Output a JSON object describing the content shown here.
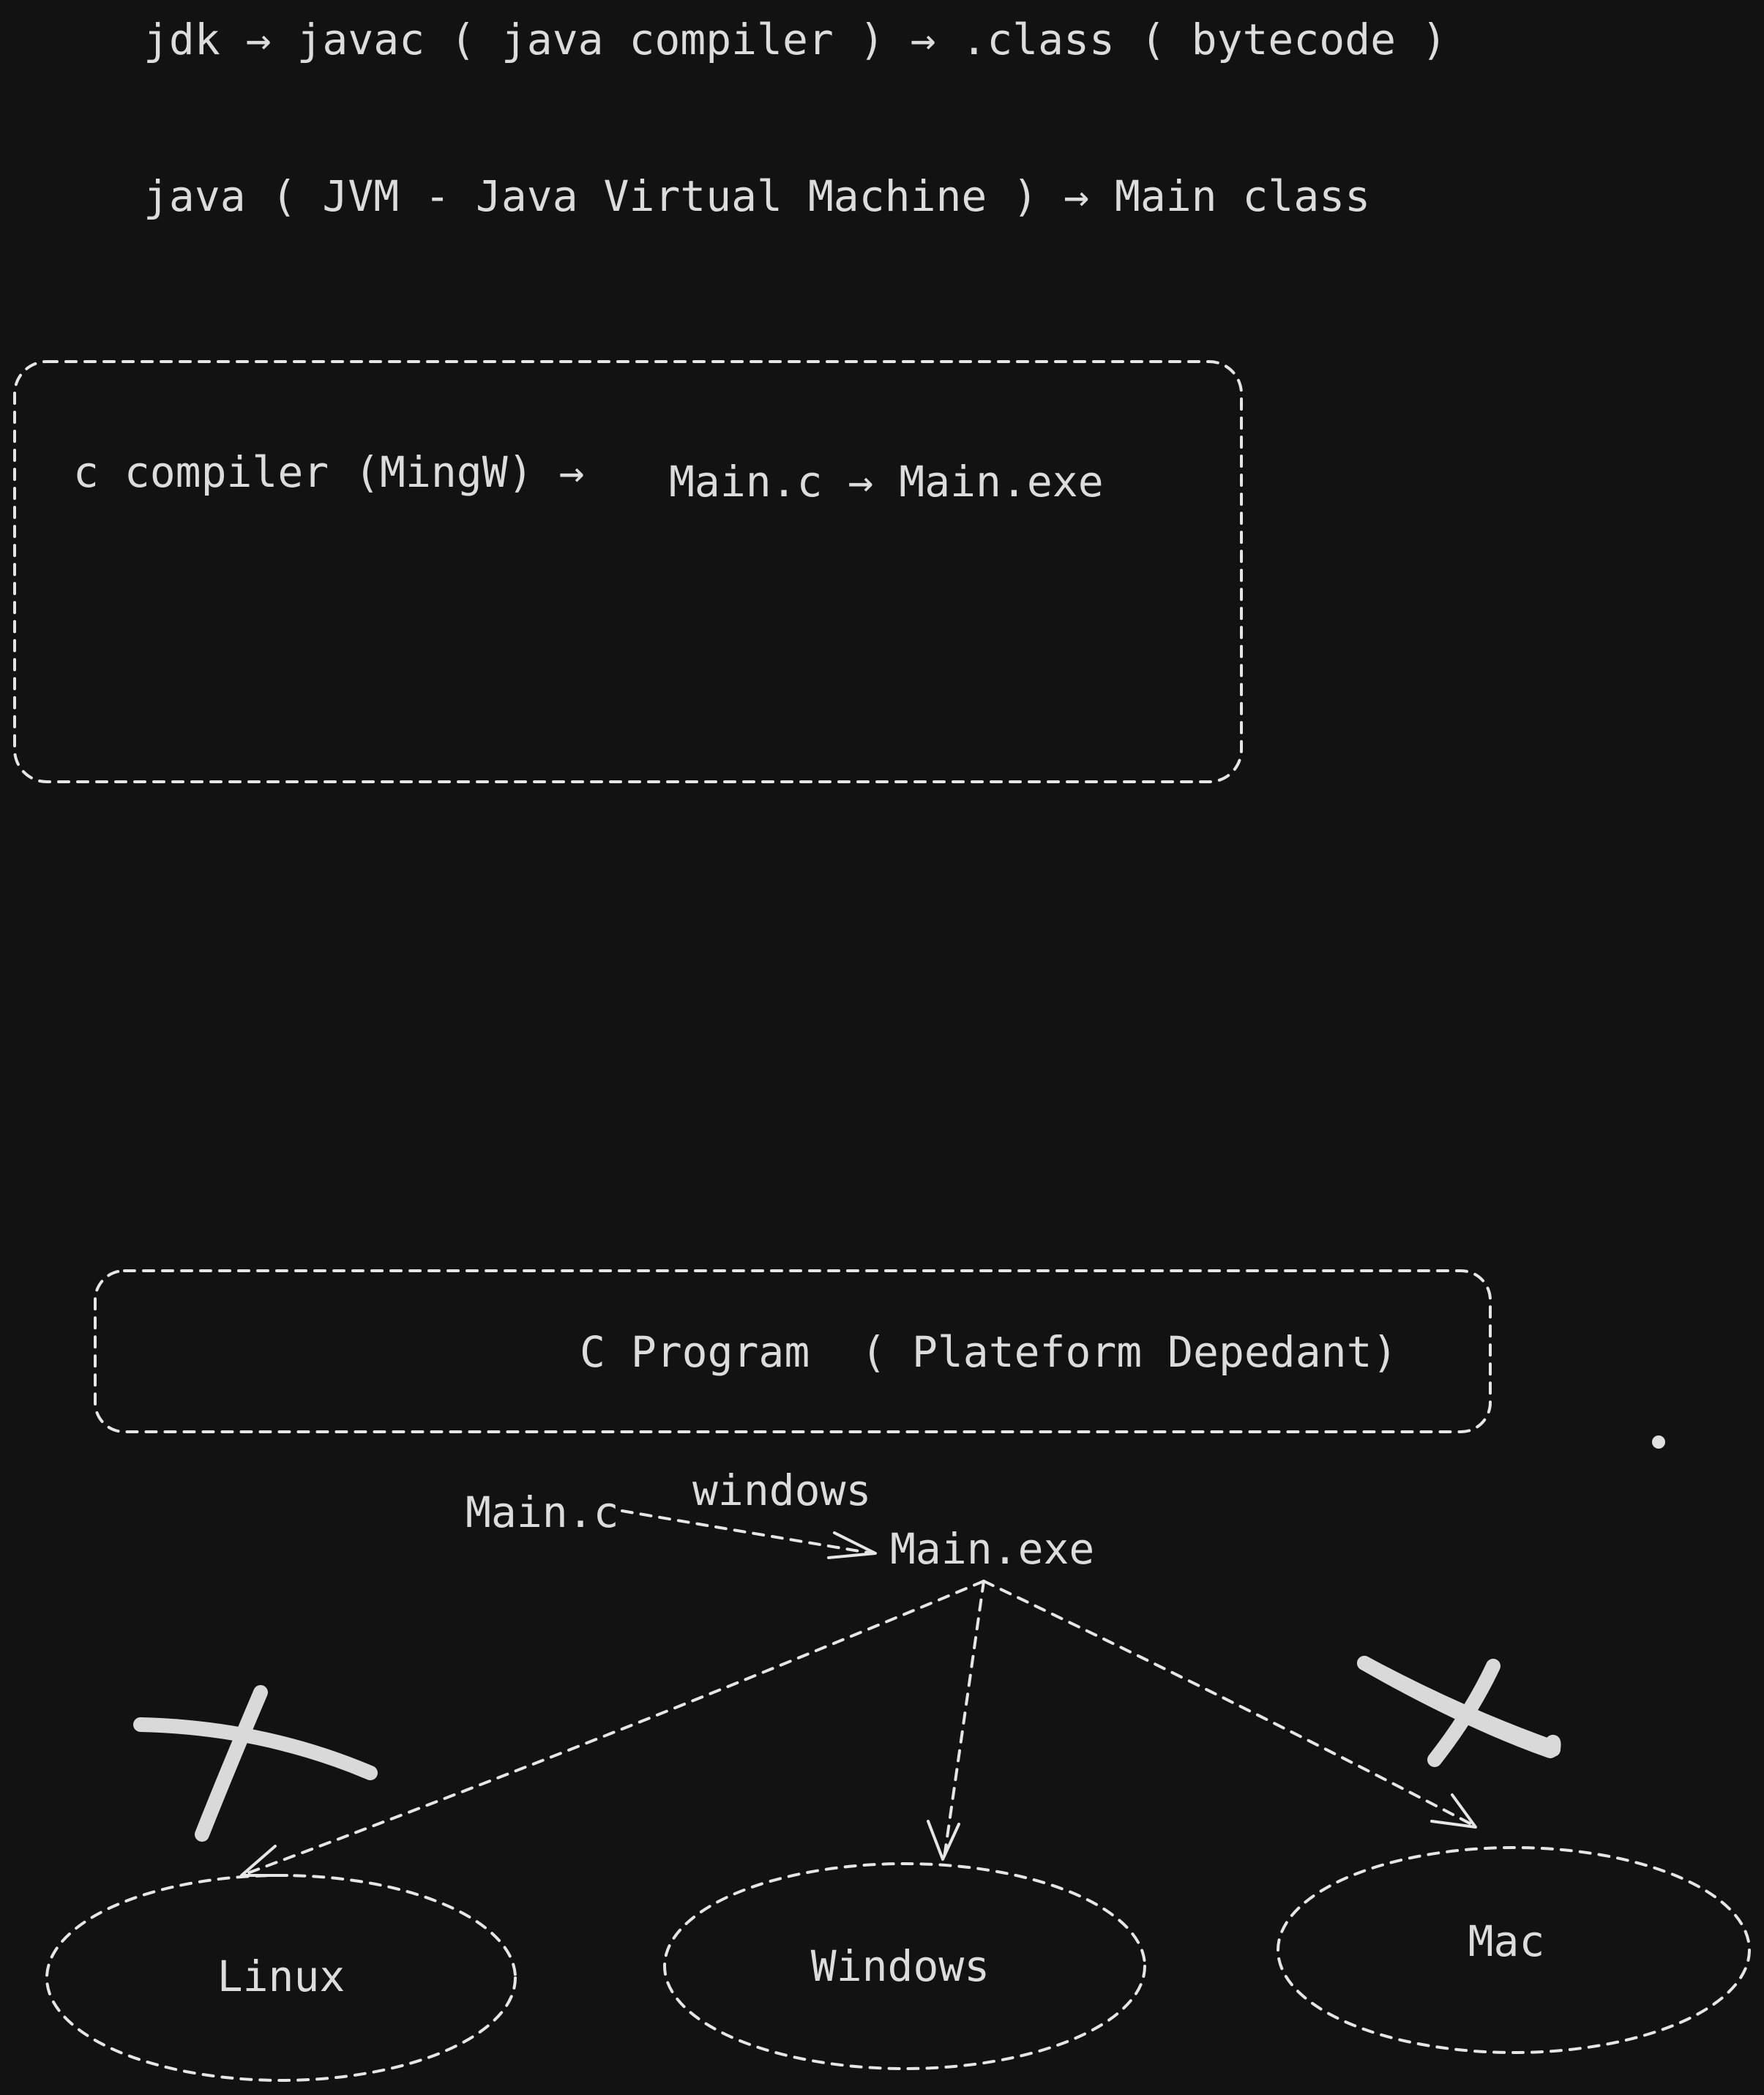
{
  "lines": {
    "jdk_line": "jdk → javac ( java compiler ) → .class ( bytecode )",
    "java_line": "java ( JVM - Java Virtual Machine ) → Main class"
  },
  "c_compiler_box": {
    "compiler_text": "c compiler (MingW) →",
    "flow_text": "Main.c → Main.exe"
  },
  "c_program_box": {
    "title": "C Program  ( Plateform Depedant)"
  },
  "flow": {
    "source": "Main.c",
    "edge_label": "windows",
    "target": "Main.exe"
  },
  "platforms": [
    {
      "label": "Linux",
      "crossed": true
    },
    {
      "label": "Windows",
      "crossed": false
    },
    {
      "label": "Mac",
      "crossed": true
    }
  ]
}
